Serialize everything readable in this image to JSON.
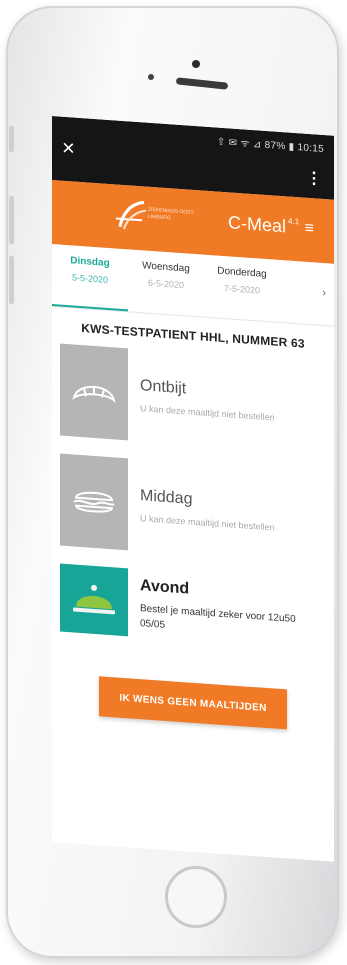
{
  "status_bar": {
    "close_label": "×",
    "status_text": "⇧ ✉ ᯤ ⊿ 87% ▮ 10:15",
    "menu_label": "⋮"
  },
  "header": {
    "logo_text": "ZIEKENHUIS OOST-LIMBURG",
    "title": "C-Meal",
    "title_sup": "4.1",
    "menu_label": "≡"
  },
  "day_tabs": [
    {
      "day": "Dinsdag",
      "date": "5-5-2020",
      "active": true
    },
    {
      "day": "Woensdag",
      "date": "6-5-2020",
      "active": false
    },
    {
      "day": "Donderdag",
      "date": "7-5-2020",
      "active": false
    }
  ],
  "next_label": "›",
  "patient_name": "KWS-TESTPATIENT HHL, NUMMER 63",
  "meals": [
    {
      "title": "Ontbijt",
      "subtitle": "U kan deze maaltijd niet bestellen",
      "icon": "croissant-icon"
    },
    {
      "title": "Middag",
      "subtitle": "U kan deze maaltijd niet bestellen",
      "icon": "sandwich-icon"
    },
    {
      "title": "Avond",
      "subtitle": "Bestel je maaltijd zeker voor 12u50 05/05",
      "icon": "cloche-icon"
    }
  ],
  "cta_label": "IK WENS GEEN MAALTIJDEN",
  "colors": {
    "brand_orange": "#f07a25",
    "accent_teal": "#16a596",
    "inactive_grey": "#b5b5b5"
  }
}
